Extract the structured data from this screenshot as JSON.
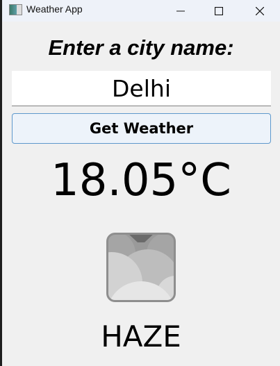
{
  "window": {
    "title": "Weather App"
  },
  "form": {
    "prompt": "Enter a city name:",
    "city_value": "Delhi",
    "button_label": "Get Weather"
  },
  "result": {
    "temperature": "18.05°C",
    "description": "HAZE",
    "icon": "haze-cloud-icon"
  },
  "colors": {
    "button_border": "#5d98cc",
    "button_bg": "#edf3fa",
    "window_bg": "#f0f0f0"
  }
}
